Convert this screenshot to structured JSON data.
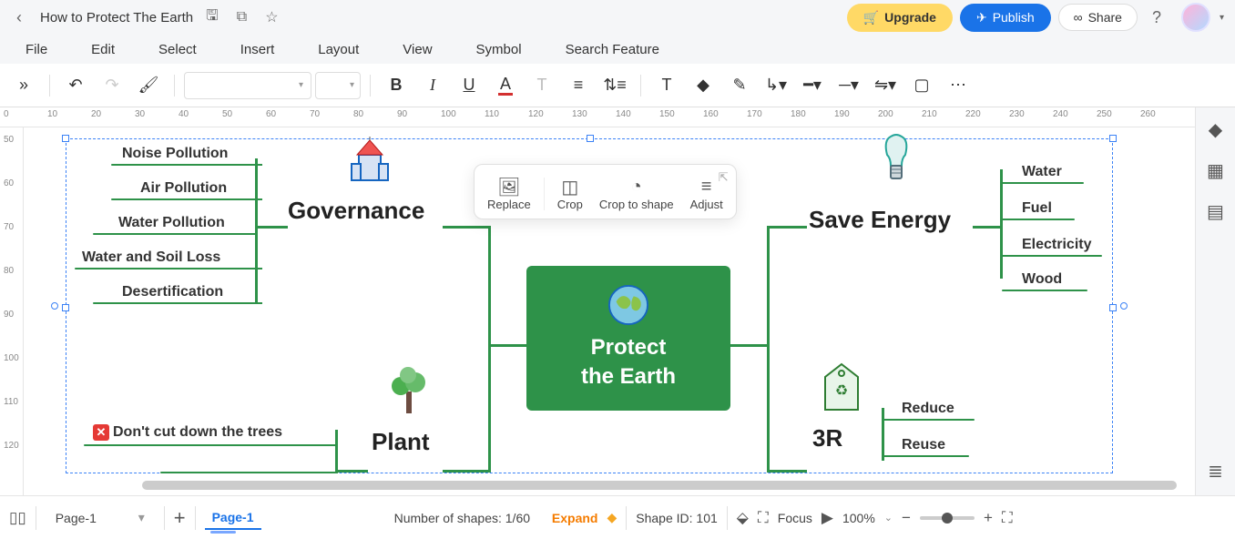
{
  "title": "How to Protect The Earth",
  "header": {
    "upgrade": "Upgrade",
    "publish": "Publish",
    "share": "Share"
  },
  "menu": {
    "file": "File",
    "edit": "Edit",
    "select": "Select",
    "insert": "Insert",
    "layout": "Layout",
    "view": "View",
    "symbol": "Symbol",
    "search": "Search Feature"
  },
  "ctx": {
    "replace": "Replace",
    "crop": "Crop",
    "croptoshape": "Crop to shape",
    "adjust": "Adjust"
  },
  "mindmap": {
    "central_l1": "Protect",
    "central_l2": "the Earth",
    "governance": "Governance",
    "gov_items": [
      "Noise Pollution",
      "Air Pollution",
      "Water Pollution",
      "Water and Soil Loss",
      "Desertification"
    ],
    "save_energy": "Save Energy",
    "energy_items": [
      "Water",
      "Fuel",
      "Electricity",
      "Wood"
    ],
    "plant": "Plant",
    "plant_item": "Don't cut down the trees",
    "three_r": "3R",
    "three_r_items": [
      "Reduce",
      "Reuse"
    ]
  },
  "ruler_h": [
    "0",
    "10",
    "20",
    "30",
    "40",
    "50",
    "60",
    "70",
    "80",
    "90",
    "100",
    "110",
    "120",
    "130",
    "140",
    "150",
    "160",
    "170",
    "180",
    "190",
    "200",
    "210",
    "220",
    "230",
    "240",
    "250",
    "260"
  ],
  "ruler_v": [
    "50",
    "60",
    "70",
    "80",
    "90",
    "100",
    "110",
    "120"
  ],
  "bottom": {
    "page_dd": "Page-1",
    "page_tab": "Page-1",
    "numshapes_label": "Number of shapes: ",
    "numshapes_val": "1/60",
    "expand": "Expand",
    "shape_id": "Shape ID: 101",
    "focus": "Focus",
    "zoom": "100%"
  }
}
